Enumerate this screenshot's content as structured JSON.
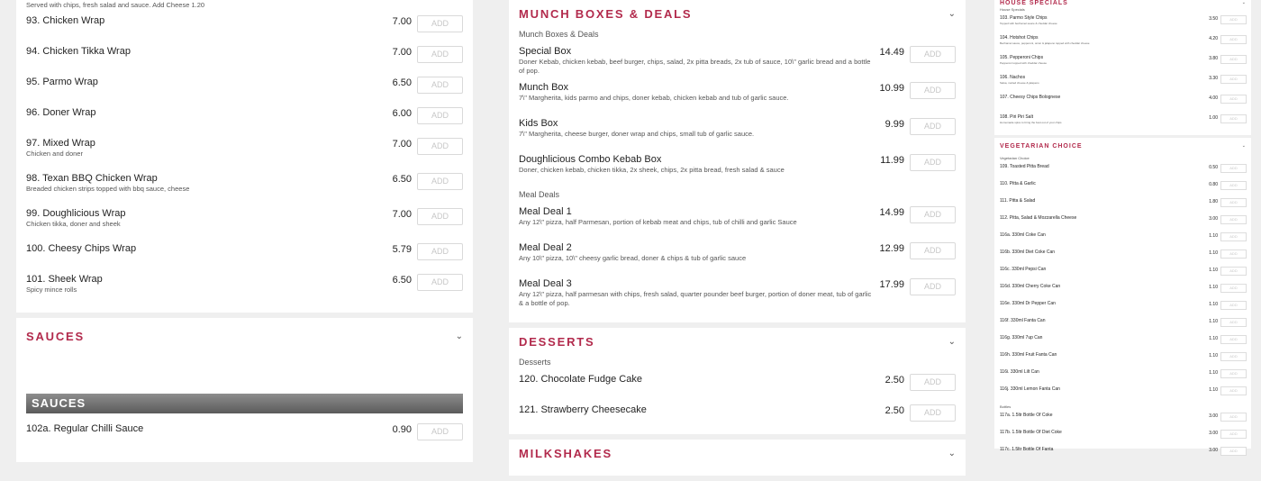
{
  "col1": {
    "top_desc": "Served with chips, fresh salad and sauce. Add Cheese 1.20",
    "items": [
      {
        "name": "93. Chicken Wrap",
        "price": "7.00",
        "desc": ""
      },
      {
        "name": "94. Chicken Tikka Wrap",
        "price": "7.00",
        "desc": ""
      },
      {
        "name": "95. Parmo Wrap",
        "price": "6.50",
        "desc": ""
      },
      {
        "name": "96. Doner Wrap",
        "price": "6.00",
        "desc": ""
      },
      {
        "name": "97. Mixed Wrap",
        "price": "7.00",
        "desc": "Chicken and doner"
      },
      {
        "name": "98. Texan BBQ Chicken Wrap",
        "price": "6.50",
        "desc": "Breaded chicken strips topped with bbq sauce, cheese"
      },
      {
        "name": "99. Doughlicious Wrap",
        "price": "7.00",
        "desc": "Chicken tikka, doner and sheek"
      },
      {
        "name": "100. Cheesy Chips Wrap",
        "price": "5.79",
        "desc": ""
      },
      {
        "name": "101. Sheek Wrap",
        "price": "6.50",
        "desc": "Spicy mince rolls"
      }
    ],
    "sauces": {
      "title": "SAUCES",
      "banner": "SAUCES",
      "items": [
        {
          "name": "102a. Regular Chilli Sauce",
          "price": "0.90",
          "desc": ""
        }
      ]
    }
  },
  "col2": {
    "munch": {
      "title": "MUNCH BOXES & DEALS",
      "subcat1": "Munch Boxes & Deals",
      "boxes": [
        {
          "name": "Special Box",
          "price": "14.49",
          "desc": "Doner Kebab, chicken kebab, beef burger, chips, salad, 2x pitta breads, 2x tub of sauce, 10\\\" garlic bread and a bottle of pop."
        },
        {
          "name": "Munch Box",
          "price": "10.99",
          "desc": "7\\\" Margherita, kids parmo and chips, doner kebab, chicken kebab and tub of garlic sauce."
        },
        {
          "name": "Kids Box",
          "price": "9.99",
          "desc": "7\\\" Margherita, cheese burger, doner wrap and chips, small tub of garlic sauce."
        },
        {
          "name": "Doughlicious Combo Kebab Box",
          "price": "11.99",
          "desc": "Doner, chicken kebab, chicken tikka, 2x sheek, chips, 2x pitta bread, fresh salad & sauce"
        }
      ],
      "subcat2": "Meal Deals",
      "deals": [
        {
          "name": "Meal Deal 1",
          "price": "14.99",
          "desc": "Any 12\\\" pizza, half Parmesan, portion of kebab meat and chips, tub of chilli and garlic Sauce"
        },
        {
          "name": "Meal Deal 2",
          "price": "12.99",
          "desc": "Any 10\\\" pizza, 10\\\" cheesy garlic bread, doner & chips & tub of garlic sauce"
        },
        {
          "name": "Meal Deal 3",
          "price": "17.99",
          "desc": "Any 12\\\" pizza, half parmesan with chips, fresh salad, quarter pounder beef burger, portion of doner meat, tub of garlic & a bottle of pop."
        }
      ]
    },
    "desserts": {
      "title": "DESSERTS",
      "subcat": "Desserts",
      "items": [
        {
          "name": "120. Chocolate Fudge Cake",
          "price": "2.50",
          "desc": ""
        },
        {
          "name": "121. Strawberry Cheesecake",
          "price": "2.50",
          "desc": ""
        }
      ]
    },
    "milkshakes": {
      "title": "MILKSHAKES"
    }
  },
  "col3": {
    "house_title": "HOUSE SPECIALS",
    "house_sub": "House Specials",
    "house_items": [
      {
        "name": "103. Parmo Style Chips",
        "price": "3.50",
        "desc": "Topped with bechamel sauce & cheddar cheese"
      },
      {
        "name": "104. Hotshot Chips",
        "price": "4.20",
        "desc": "Bechamel sauce, pepperoni, onion & jalapeno topped with cheddar cheese"
      },
      {
        "name": "105. Pepperoni Chips",
        "price": "3.80",
        "desc": "Pepperoni topped with cheddar cheese"
      },
      {
        "name": "106. Nachos",
        "price": "3.30",
        "desc": "Salsa, melted cheese & jalapeno"
      },
      {
        "name": "107. Cheesy Chips Bolognese",
        "price": "4.00",
        "desc": ""
      },
      {
        "name": "108. Piri Piri Salt",
        "price": "1.00",
        "desc": "Homemade spice to bring the best out of your chips"
      }
    ],
    "veg_title": "VEGETARIAN CHOICE",
    "veg_sub": "Vegetarian Choice",
    "veg_items": [
      {
        "name": "109. Toasted Pitta Bread",
        "price": "0.50"
      },
      {
        "name": "110. Pitta & Garlic",
        "price": "0.80"
      },
      {
        "name": "111. Pitta & Salad",
        "price": "1.80"
      },
      {
        "name": "112. Pitta, Salad & Mozzarella Cheese",
        "price": "3.00"
      }
    ],
    "drink_items": [
      {
        "name": "116a. 330ml Coke Can",
        "price": "1.10"
      },
      {
        "name": "116b. 330ml Diet Coke Can",
        "price": "1.10"
      },
      {
        "name": "116c. 330ml Pepsi Can",
        "price": "1.10"
      },
      {
        "name": "116d. 330ml Cherry Coke Can",
        "price": "1.10"
      },
      {
        "name": "116e. 330ml Dr Pepper Can",
        "price": "1.10"
      },
      {
        "name": "116f. 330ml Fanta Can",
        "price": "1.10"
      },
      {
        "name": "116g. 330ml 7up Can",
        "price": "1.10"
      },
      {
        "name": "116h. 330ml Fruit Fanta Can",
        "price": "1.10"
      },
      {
        "name": "116i. 330ml Lilt Can",
        "price": "1.10"
      },
      {
        "name": "116j. 330ml Lemon Fanta Can",
        "price": "1.10"
      }
    ],
    "bottles_sub": "Bottles",
    "bottle_items": [
      {
        "name": "117a. 1.5ltr Bottle Of Coke",
        "price": "3.00"
      },
      {
        "name": "117b. 1.5ltr Bottle Of Diet Coke",
        "price": "3.00"
      },
      {
        "name": "117c. 1.5ltr Bottle Of Fanta",
        "price": "3.00"
      }
    ]
  },
  "add_label": "ADD",
  "chevron": "⌄"
}
